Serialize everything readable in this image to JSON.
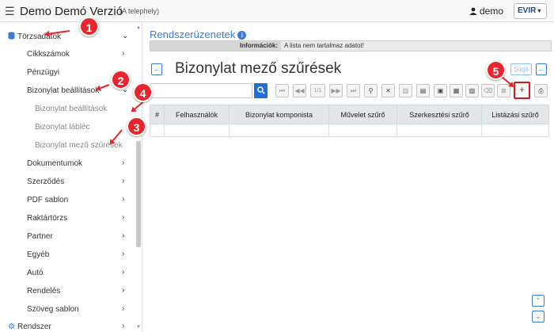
{
  "header": {
    "menu_icon": "hamburger-icon",
    "title": "Demo Demó Verzió",
    "subtitle": "(A telephely)",
    "user": "demo",
    "logo": "EVIR",
    "logo_caret": "▾"
  },
  "sidebar": {
    "items": [
      {
        "label": "Törzsadatok",
        "chevron": "⌄"
      },
      {
        "label": "Cikkszámok",
        "chevron": "›"
      },
      {
        "label": "Pénzügyi"
      },
      {
        "label": "Bizonylat beállítások",
        "chevron": "⌄"
      },
      {
        "label": "Bizonylat beállítások"
      },
      {
        "label": "Bizonylat lábléc"
      },
      {
        "label": "Bizonylat mező szűrések"
      },
      {
        "label": "Dokumentumok",
        "chevron": "›"
      },
      {
        "label": "Szerződés",
        "chevron": "›"
      },
      {
        "label": "PDF sablon",
        "chevron": "›"
      },
      {
        "label": "Raktártörzs",
        "chevron": "›"
      },
      {
        "label": "Partner",
        "chevron": "›"
      },
      {
        "label": "Egyéb",
        "chevron": "›"
      },
      {
        "label": "Autó",
        "chevron": "›"
      },
      {
        "label": "Rendelés",
        "chevron": "›"
      },
      {
        "label": "Szöveg sablon",
        "chevron": "›"
      },
      {
        "label": "Rendszer",
        "chevron": "›"
      }
    ]
  },
  "main": {
    "messages_title": "Rendszerüzenetek",
    "info_label": "Információk:",
    "info_text": "A lista nem tartalmaz adatot!",
    "page_title": "Bizonylat mező szűrések",
    "help_label": "Súgó",
    "back_symbol": "←",
    "search_placeholder": "",
    "pager_text": "1/1",
    "add_symbol": "+",
    "columns": [
      "#",
      "Felhasználók",
      "Bizonylat komponista",
      "Művelet szűrő",
      "Szerkesztési szűrő",
      "Listázási szűrő"
    ]
  },
  "annotations": [
    "1",
    "2",
    "3",
    "4",
    "5"
  ],
  "colors": {
    "accent": "#3a7bd5",
    "annotation": "#e8252c",
    "search_button": "#1e6fd9"
  }
}
